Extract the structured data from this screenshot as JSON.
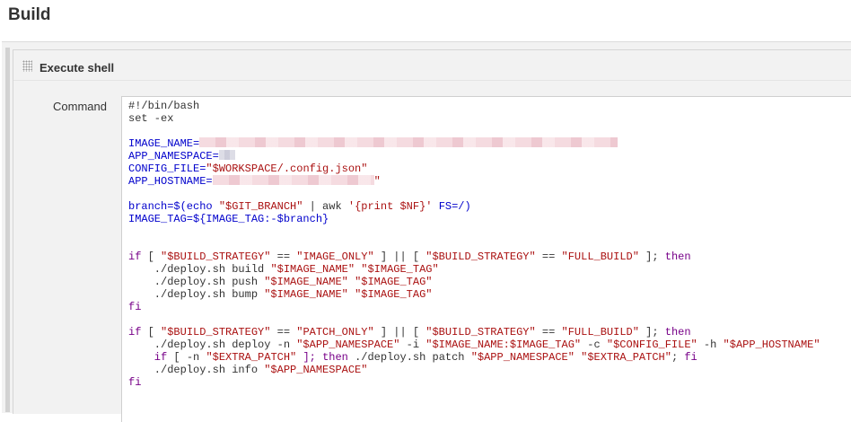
{
  "section": {
    "title": "Build"
  },
  "step": {
    "title": "Execute shell"
  },
  "field": {
    "label": "Command"
  },
  "script": {
    "shebang": "#!/bin/bash",
    "set_ex": "set -ex",
    "image_name_key": "IMAGE_NAME=",
    "app_namespace_key": "APP_NAMESPACE=",
    "config_file_key": "CONFIG_FILE=",
    "config_file_val": "\"$WORKSPACE/.config.json\"",
    "app_hostname_key": "APP_HOSTNAME=",
    "quote_end": "\"",
    "branch_key": "branch=$(echo ",
    "branch_var": "\"$GIT_BRANCH\"",
    "branch_pipe": " | awk ",
    "branch_awk": "'{print $NF}'",
    "branch_fs": " FS=/)",
    "image_tag_line": "IMAGE_TAG=${IMAGE_TAG:-$branch}",
    "if1_if": "if",
    "if1_open": " [ ",
    "build_strategy": "\"$BUILD_STRATEGY\"",
    "eq": " == ",
    "image_only": "\"IMAGE_ONLY\"",
    "or": " ] || [ ",
    "full_build": "\"FULL_BUILD\"",
    "close_semi": " ]; ",
    "then": "then",
    "build_cmd": "    ./deploy.sh build ",
    "push_cmd": "    ./deploy.sh push ",
    "bump_cmd": "    ./deploy.sh bump ",
    "image_name_var": "\"$IMAGE_NAME\"",
    "image_tag_var": "\"$IMAGE_TAG\"",
    "sp": " ",
    "fi": "fi",
    "patch_only": "\"PATCH_ONLY\"",
    "deploy_cmd": "    ./deploy.sh deploy -n ",
    "app_namespace_var": "\"$APP_NAMESPACE\"",
    "flag_i": " -i ",
    "image_full_var": "\"$IMAGE_NAME:$IMAGE_TAG\"",
    "flag_c": " -c ",
    "config_file_var": "\"$CONFIG_FILE\"",
    "flag_h": " -h ",
    "app_hostname_var": "\"$APP_HOSTNAME\"",
    "extra_if": "    if",
    "extra_test": " [ -n ",
    "extra_patch_var": "\"$EXTRA_PATCH\"",
    "extra_then": " ]; then ",
    "patch_cmd": "./deploy.sh patch ",
    "semi": "; ",
    "fi_inline": "fi",
    "info_cmd": "    ./deploy.sh info "
  },
  "colors": {
    "keyword": "#770088",
    "variable": "#0000cc",
    "string": "#aa1111",
    "panel_bg": "#f2f2f2",
    "editor_bg": "#ffffff"
  }
}
